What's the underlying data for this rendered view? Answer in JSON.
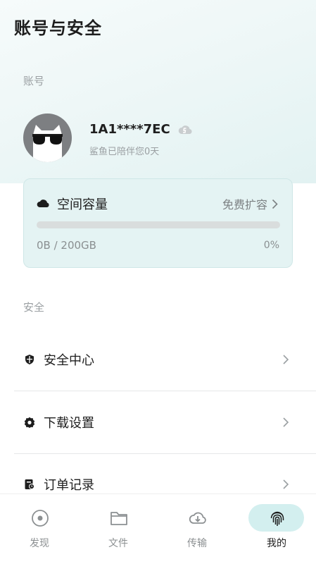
{
  "header": {
    "title": "账号与安全"
  },
  "account_section": {
    "label": "账号"
  },
  "profile": {
    "username": "1A1****7EC",
    "days_text": "鲨鱼已陪伴您0天"
  },
  "storage": {
    "title": "空间容量",
    "expand_label": "免费扩容",
    "used_text": "0B / 200GB",
    "percent_text": "0%",
    "progress": 0
  },
  "security_section": {
    "label": "安全"
  },
  "menu": [
    {
      "label": "安全中心",
      "icon": "shield-icon"
    },
    {
      "label": "下载设置",
      "icon": "gear-icon"
    },
    {
      "label": "订单记录",
      "icon": "order-icon"
    }
  ],
  "bottom_nav": [
    {
      "label": "发现",
      "icon": "discover-icon",
      "active": false
    },
    {
      "label": "文件",
      "icon": "folder-icon",
      "active": false
    },
    {
      "label": "传输",
      "icon": "cloud-download-icon",
      "active": false
    },
    {
      "label": "我的",
      "icon": "fingerprint-icon",
      "active": true
    }
  ],
  "colors": {
    "accent": "#d3efef",
    "card_bg": "#e4f3f3",
    "muted_text": "#9a9fa2"
  }
}
